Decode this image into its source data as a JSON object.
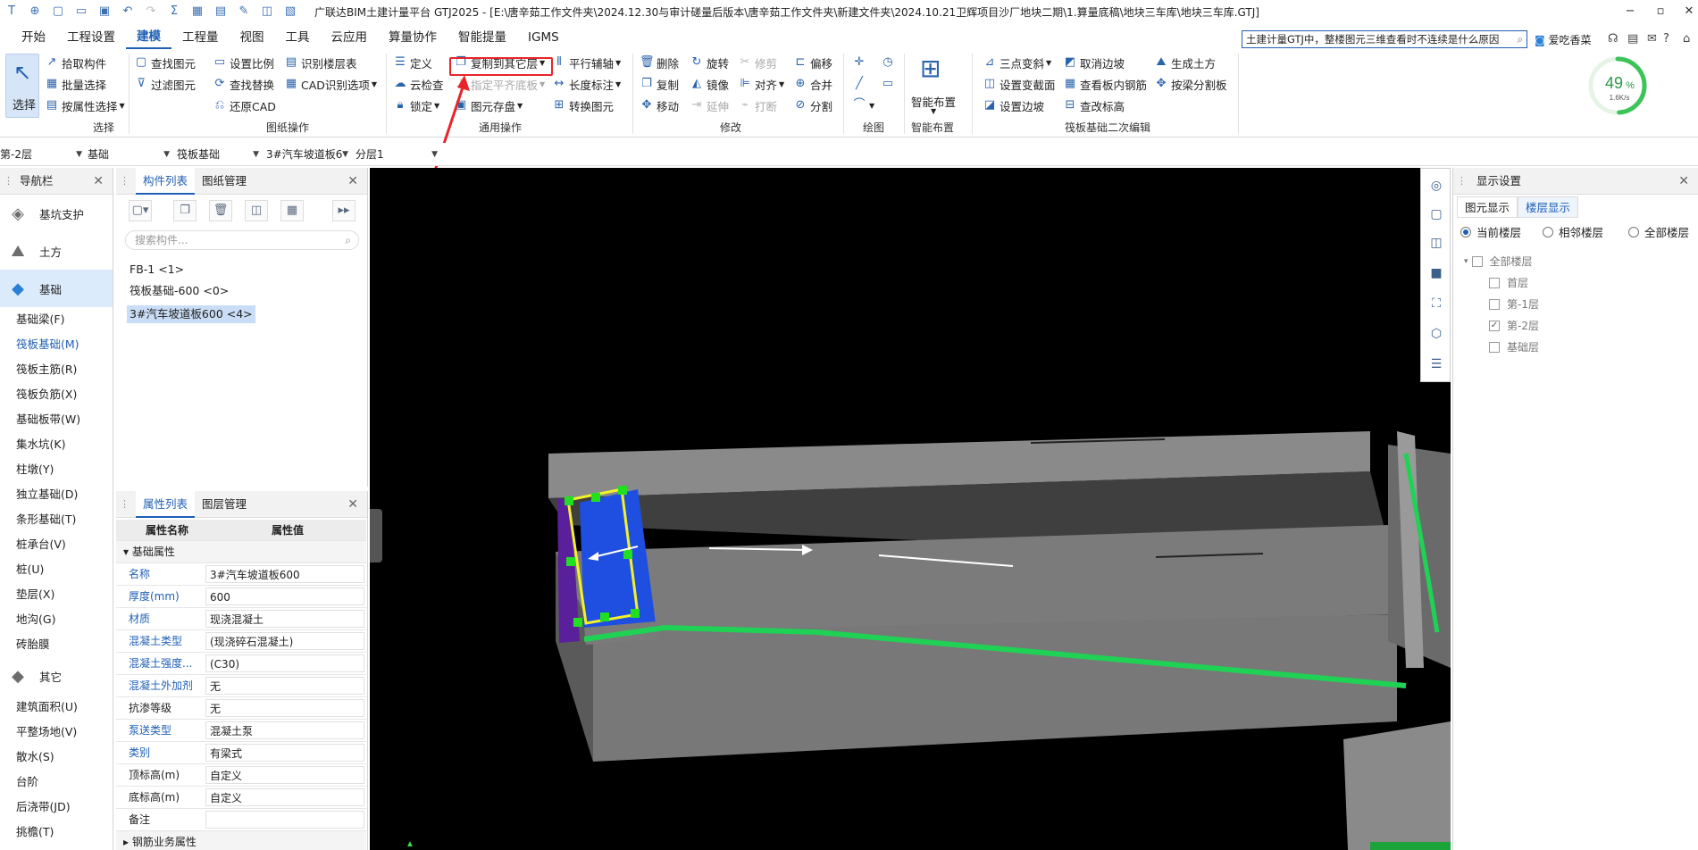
{
  "titlebar": {
    "title": "广联达BIM土建计量平台 GTJ2025 - [E:\\唐辛茹工作文件夹\\2024.12.30与审计磋量后版本\\唐辛茹工作文件夹\\新建文件夹\\2024.10.21卫辉项目沙厂地块二期\\1.算量底稿\\地块三车库\\地块三车库.GTJ]"
  },
  "menubar": {
    "items": [
      "开始",
      "工程设置",
      "建模",
      "工程量",
      "视图",
      "工具",
      "云应用",
      "算量协作",
      "智能提量",
      "IGMS"
    ],
    "active": "建模",
    "search_value": "土建计量GTJ中，整楼图元三维查看时不连续是什么原因",
    "user": "爱吃香菜"
  },
  "ribbon": {
    "select": {
      "big": "选择",
      "pick": "拾取构件",
      "batch": "批量选择",
      "by_attr": "按属性选择",
      "label": "选择"
    },
    "drawing_ops": {
      "find": "查找图元",
      "filter": "过滤图元",
      "set_scale": "设置比例",
      "find_replace": "查找替换",
      "restore_cad": "还原CAD",
      "identify_floor": "识别楼层表",
      "cad_options": "CAD识别选项",
      "label": "图纸操作"
    },
    "common_ops": {
      "define": "定义",
      "cloud_check": "云检查",
      "lock": "锁定",
      "copy_to_floor": "复制到其它层",
      "align_bottom": "指定平齐底板",
      "save_elem": "图元存盘",
      "parallel_axis": "平行辅轴",
      "length_mark": "长度标注",
      "convert": "转换图元",
      "label": "通用操作"
    },
    "modify": {
      "delete": "删除",
      "rotate": "旋转",
      "trim": "修剪",
      "offset": "偏移",
      "copy": "复制",
      "mirror": "镜像",
      "align": "对齐",
      "merge": "合并",
      "move": "移动",
      "extend": "延伸",
      "break": "打断",
      "split": "分割",
      "label": "修改"
    },
    "draw": {
      "label": "绘图"
    },
    "smart": {
      "btn": "智能布置",
      "label": "智能布置"
    },
    "raft_edit": {
      "three_point": "三点变斜",
      "set_slope": "设置变截面",
      "set_edge": "设置边坡",
      "cancel_edge": "取消边坡",
      "view_rebar": "查看板内钢筋",
      "modify_elev": "查改标高",
      "gen_earth": "生成土方",
      "split_by_beam": "按梁分割板",
      "label": "筏板基础二次编辑"
    }
  },
  "gauge": {
    "percent": "49",
    "unit": "%",
    "speed": "1.6K/s"
  },
  "floorbar": {
    "floor": "第-2层",
    "type": "基础",
    "subtype": "筏板基础",
    "component": "3#汽车坡道板6",
    "layer": "分层1"
  },
  "nav": {
    "title": "导航栏",
    "cats": [
      {
        "name": "基坑支护",
        "icon": "pit-icon"
      },
      {
        "name": "土方",
        "icon": "earth-icon"
      },
      {
        "name": "基础",
        "icon": "foundation-icon"
      }
    ],
    "subs": [
      "基础梁(F)",
      "筏板基础(M)",
      "筏板主筋(R)",
      "筏板负筋(X)",
      "基础板带(W)",
      "集水坑(K)",
      "柱墩(Y)",
      "独立基础(D)",
      "条形基础(T)",
      "桩承台(V)",
      "桩(U)",
      "垫层(X)",
      "地沟(G)",
      "砖胎膜"
    ],
    "active_sub": "筏板基础(M)",
    "other_cat": "其它",
    "other_subs": [
      "建筑面积(U)",
      "平整场地(V)",
      "散水(S)",
      "台阶",
      "后浇带(JD)",
      "挑檐(T)"
    ]
  },
  "complist": {
    "tabs": [
      "构件列表",
      "图纸管理"
    ],
    "search_placeholder": "搜索构件...",
    "items": [
      "FB-1 <1>",
      "筏板基础-600 <0>",
      "3#汽车坡道板600 <4>"
    ]
  },
  "proppanel": {
    "tabs": [
      "属性列表",
      "图层管理"
    ],
    "col_name": "属性名称",
    "col_value": "属性值",
    "section": "基础属性",
    "rows": [
      {
        "name": "名称",
        "value": "3#汽车坡道板600",
        "blue": true
      },
      {
        "name": "厚度(mm)",
        "value": "600",
        "blue": true
      },
      {
        "name": "材质",
        "value": "现浇混凝土",
        "blue": true
      },
      {
        "name": "混凝土类型",
        "value": "(现浇碎石混凝土)",
        "blue": true
      },
      {
        "name": "混凝土强度...",
        "value": "(C30)",
        "blue": true
      },
      {
        "name": "混凝土外加剂",
        "value": "无",
        "blue": true
      },
      {
        "name": "抗渗等级",
        "value": "无",
        "blue": false
      },
      {
        "name": "泵送类型",
        "value": "混凝土泵",
        "blue": true
      },
      {
        "name": "类别",
        "value": "有梁式",
        "blue": true
      },
      {
        "name": "顶标高(m)",
        "value": "自定义",
        "blue": false
      },
      {
        "name": "底标高(m)",
        "value": "自定义",
        "blue": false
      },
      {
        "name": "备注",
        "value": "",
        "blue": false
      }
    ],
    "rebar_section": "钢筋业务属性"
  },
  "dispset": {
    "title": "显示设置",
    "tabs": [
      "图元显示",
      "楼层显示"
    ],
    "radios": [
      "当前楼层",
      "相邻楼层",
      "全部楼层"
    ],
    "tree_root": "全部楼层",
    "floors": [
      {
        "name": "首层",
        "checked": false
      },
      {
        "name": "第-1层",
        "checked": false
      },
      {
        "name": "第-2层",
        "checked": true
      },
      {
        "name": "基础层",
        "checked": false
      }
    ]
  },
  "colors": {
    "accent": "#1f5fb4",
    "highlight": "#e8242a",
    "selection": "#f2f22a",
    "slab": "#1f4fe0",
    "grip": "#21e021"
  }
}
